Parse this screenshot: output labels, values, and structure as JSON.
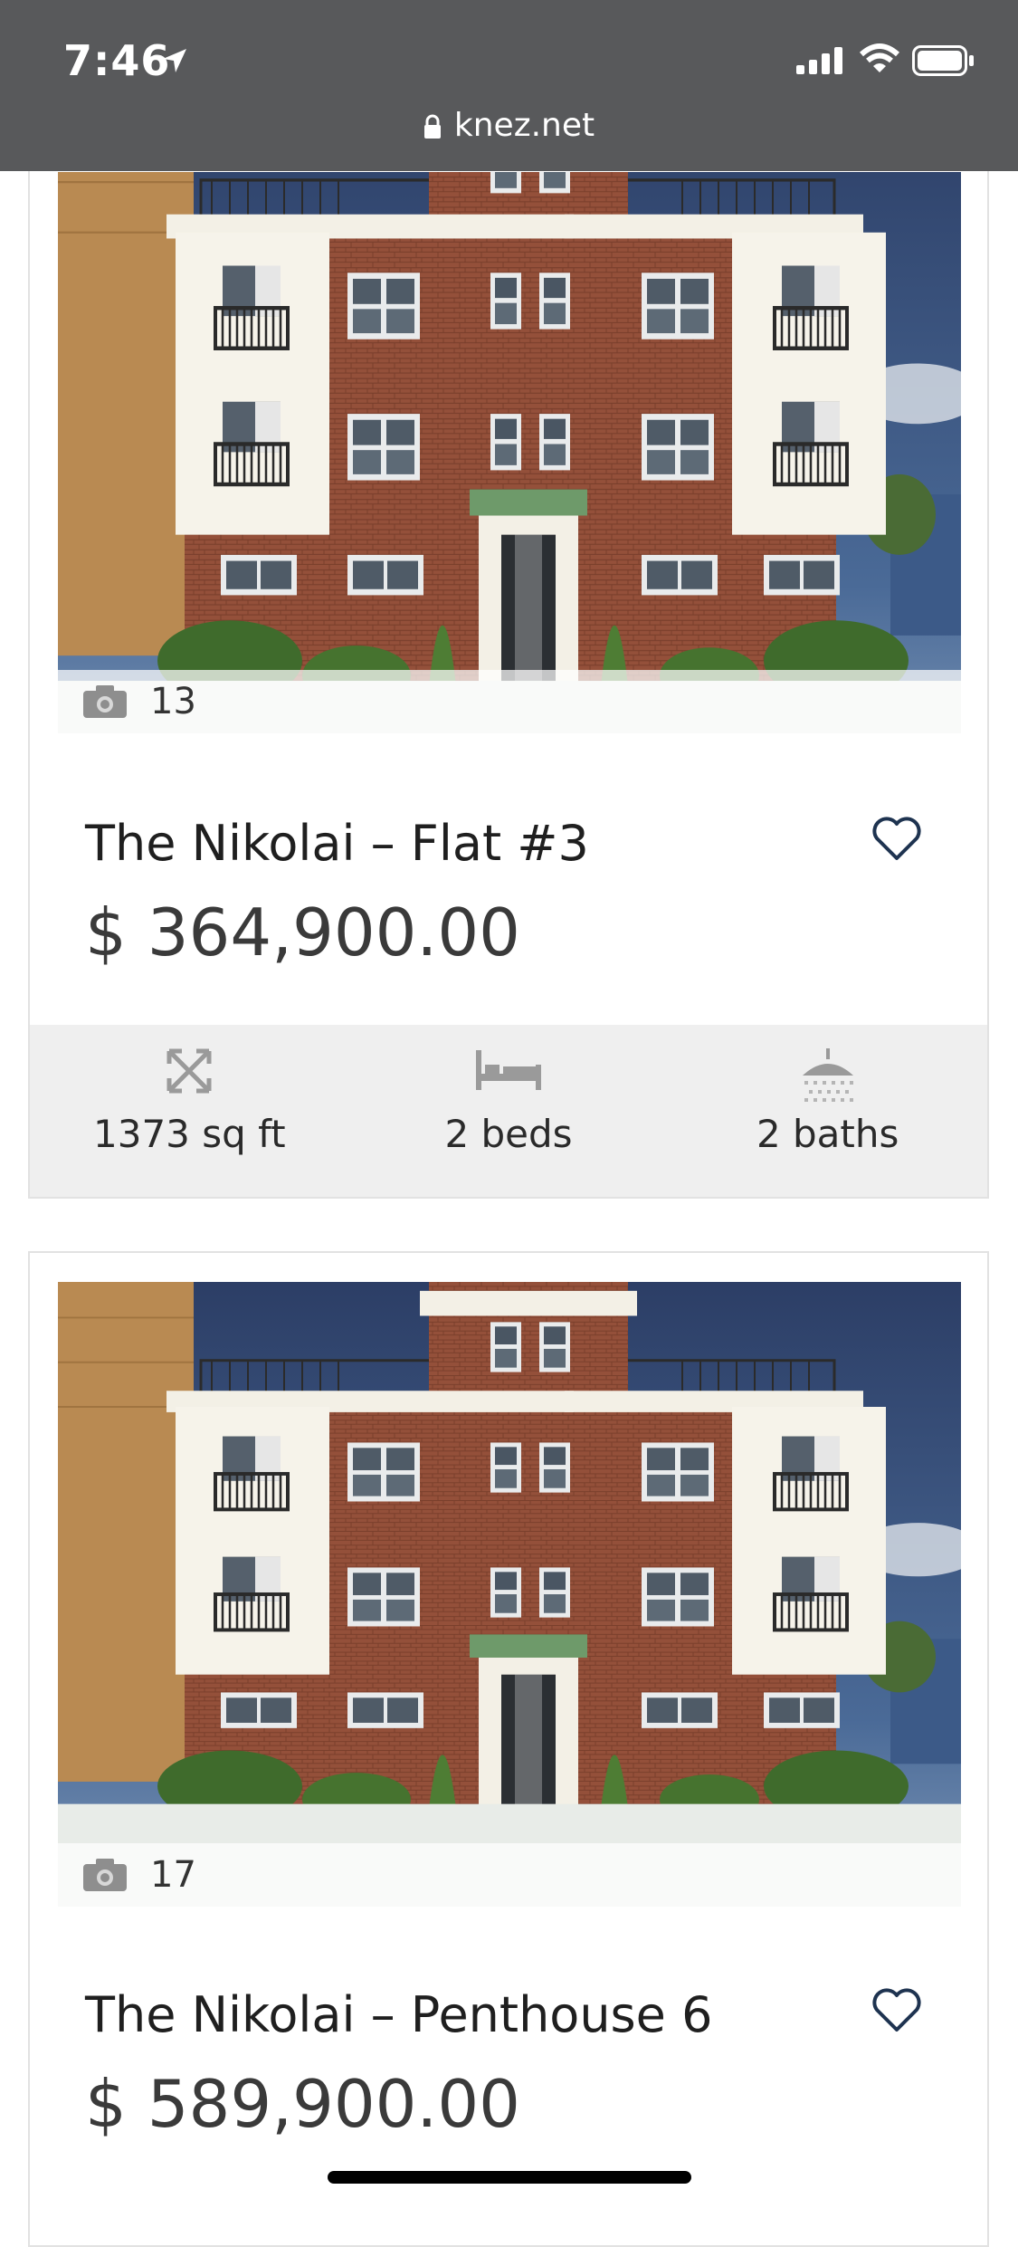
{
  "status_bar": {
    "time": "7:46"
  },
  "browser": {
    "url": "knez.net"
  },
  "listings": [
    {
      "title": "The Nikolai – Flat #3",
      "price": "$ 364,900.00",
      "photo_count": "13",
      "features": {
        "area": "1373 sq ft",
        "beds": "2 beds",
        "baths": "2 baths"
      }
    },
    {
      "title": "The Nikolai – Penthouse 6",
      "price": "$ 589,900.00",
      "photo_count": "17"
    }
  ],
  "icons": [
    "location-arrow-icon",
    "signal-icon",
    "wifi-icon",
    "battery-icon",
    "lock-icon",
    "camera-icon",
    "heart-icon",
    "expand-icon",
    "bed-icon",
    "shower-icon"
  ],
  "colors": {
    "topbar": "#58595b",
    "feature_bg": "#efefef",
    "heart": "#1e3350",
    "brick": "#8e4a30"
  }
}
